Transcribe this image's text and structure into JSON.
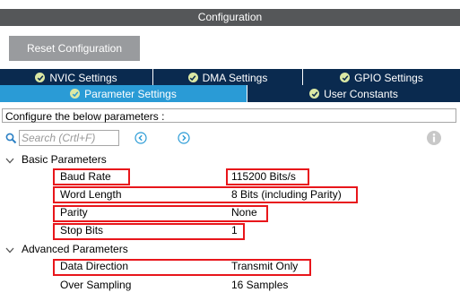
{
  "header": {
    "title": "Configuration"
  },
  "toolbar": {
    "reset_label": "Reset Configuration"
  },
  "tabs_row1": [
    {
      "label": "NVIC Settings",
      "icon": "check-circle-icon"
    },
    {
      "label": "DMA Settings",
      "icon": "check-circle-icon"
    },
    {
      "label": "GPIO Settings",
      "icon": "check-circle-icon"
    }
  ],
  "tabs_row2": [
    {
      "label": "Parameter Settings",
      "icon": "check-circle-icon",
      "active": true
    },
    {
      "label": "User Constants",
      "icon": "check-circle-icon",
      "active": false
    }
  ],
  "description": "Configure the below parameters :",
  "search": {
    "placeholder": "Search (Crtl+F)"
  },
  "groups": [
    {
      "label": "Basic Parameters",
      "params": [
        {
          "name": "Baud Rate",
          "value": "115200 Bits/s",
          "highlighted": true
        },
        {
          "name": "Word Length",
          "value": "8 Bits (including Parity)",
          "highlighted": true
        },
        {
          "name": "Parity",
          "value": "None",
          "highlighted": true
        },
        {
          "name": "Stop Bits",
          "value": "1",
          "highlighted": true
        }
      ]
    },
    {
      "label": "Advanced Parameters",
      "params": [
        {
          "name": "Data Direction",
          "value": "Transmit Only",
          "highlighted": true
        },
        {
          "name": "Over Sampling",
          "value": "16 Samples",
          "highlighted": false
        }
      ]
    }
  ],
  "colors": {
    "tab_dark": "#0a2a4f",
    "tab_active": "#2a9bd6",
    "highlight": "#e8161b",
    "check": "#dbe8a4"
  }
}
